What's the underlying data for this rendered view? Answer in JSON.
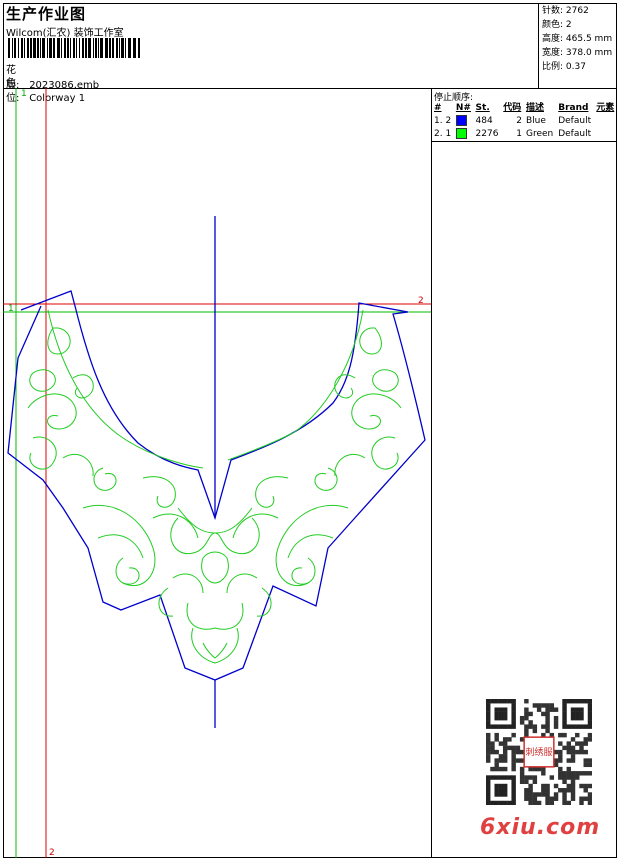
{
  "header": {
    "title": "生产作业图",
    "company": "Wilcom(汇农) 装饰工作室",
    "design_label": "花版:",
    "design_value": "2023086.emb",
    "colorway_label": "色位:",
    "colorway_value": "Colorway 1"
  },
  "stats": [
    {
      "label": "针数:",
      "value": "2762"
    },
    {
      "label": "颜色:",
      "value": "2"
    },
    {
      "label": "高度:",
      "value": "465.5 mm"
    },
    {
      "label": "宽度:",
      "value": "378.0 mm"
    },
    {
      "label": "比例:",
      "value": "0.37"
    }
  ],
  "legend": {
    "title": "停止顺序:",
    "headers": [
      "#",
      "N#",
      "St.",
      "代码",
      "描述",
      "Brand",
      "元素"
    ],
    "rows": [
      {
        "num": "1.",
        "needle": "2",
        "color": "#0000ff",
        "stitches": "484",
        "code": "2",
        "desc": "Blue",
        "brand": "Default"
      },
      {
        "num": "2.",
        "needle": "1",
        "color": "#00ff00",
        "stitches": "2276",
        "code": "1",
        "desc": "Green",
        "brand": "Default"
      }
    ]
  },
  "markers": {
    "green_left": "1",
    "green_top": "1",
    "red_right": "2",
    "red_bottom": "2"
  },
  "colors": {
    "blue_outline": "#0000cc",
    "green_stitch": "#22cc22",
    "guide_red": "#dd0000",
    "guide_green": "#00bb00"
  },
  "watermark": {
    "text": "6xiu.com",
    "qr_stamp": "刺绣服"
  }
}
